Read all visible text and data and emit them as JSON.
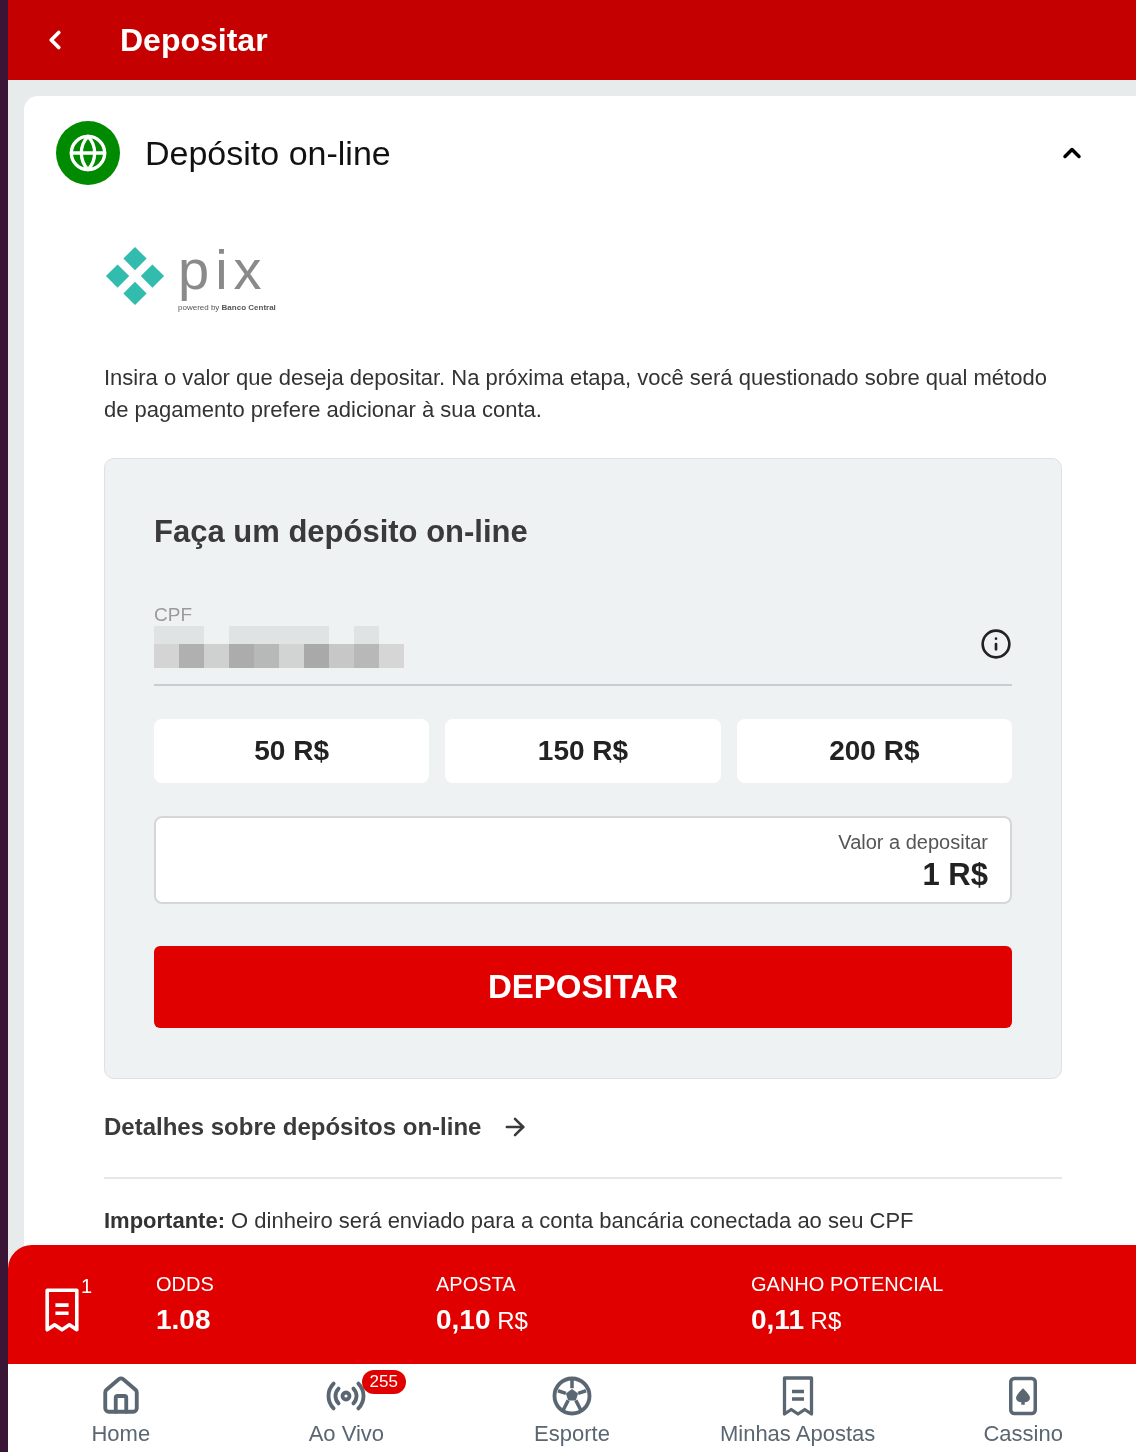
{
  "header": {
    "title": "Depositar"
  },
  "section": {
    "title": "Depósito on-line",
    "expanded": true
  },
  "pix_logo": {
    "wordmark": "pix",
    "tagline": "powered by **Banco Central**"
  },
  "intro": "Insira o valor que deseja depositar. Na próxima etapa, você será questionado sobre qual método de pagamento prefere adicionar à sua conta.",
  "form": {
    "title": "Faça um depósito on-line",
    "cpf_label": "CPF",
    "presets": [
      {
        "label": "50 R$"
      },
      {
        "label": "150 R$"
      },
      {
        "label": "200 R$"
      }
    ],
    "amount_label": "Valor a depositar",
    "amount_value": "1 R$",
    "submit": "DEPOSITAR"
  },
  "details_link": "Detalhes sobre depósitos on-line",
  "notice": "**Importante:** O dinheiro será enviado para a conta bancária conectada ao seu CPF",
  "bet_slip": {
    "count": "1",
    "stats": [
      {
        "label": "ODDS",
        "value": "1.08"
      },
      {
        "label": "APOSTA",
        "value": "0,10",
        "currency": "R$"
      },
      {
        "label": "GANHO POTENCIAL",
        "value": "0,11",
        "currency": "R$"
      }
    ]
  },
  "nav": [
    {
      "kind": "home",
      "label": "Home"
    },
    {
      "kind": "live",
      "label": "Ao Vivo",
      "badge": "255"
    },
    {
      "kind": "sport",
      "label": "Esporte"
    },
    {
      "kind": "bets",
      "label": "Minhas Apostas"
    },
    {
      "kind": "casino",
      "label": "Cassino"
    }
  ]
}
